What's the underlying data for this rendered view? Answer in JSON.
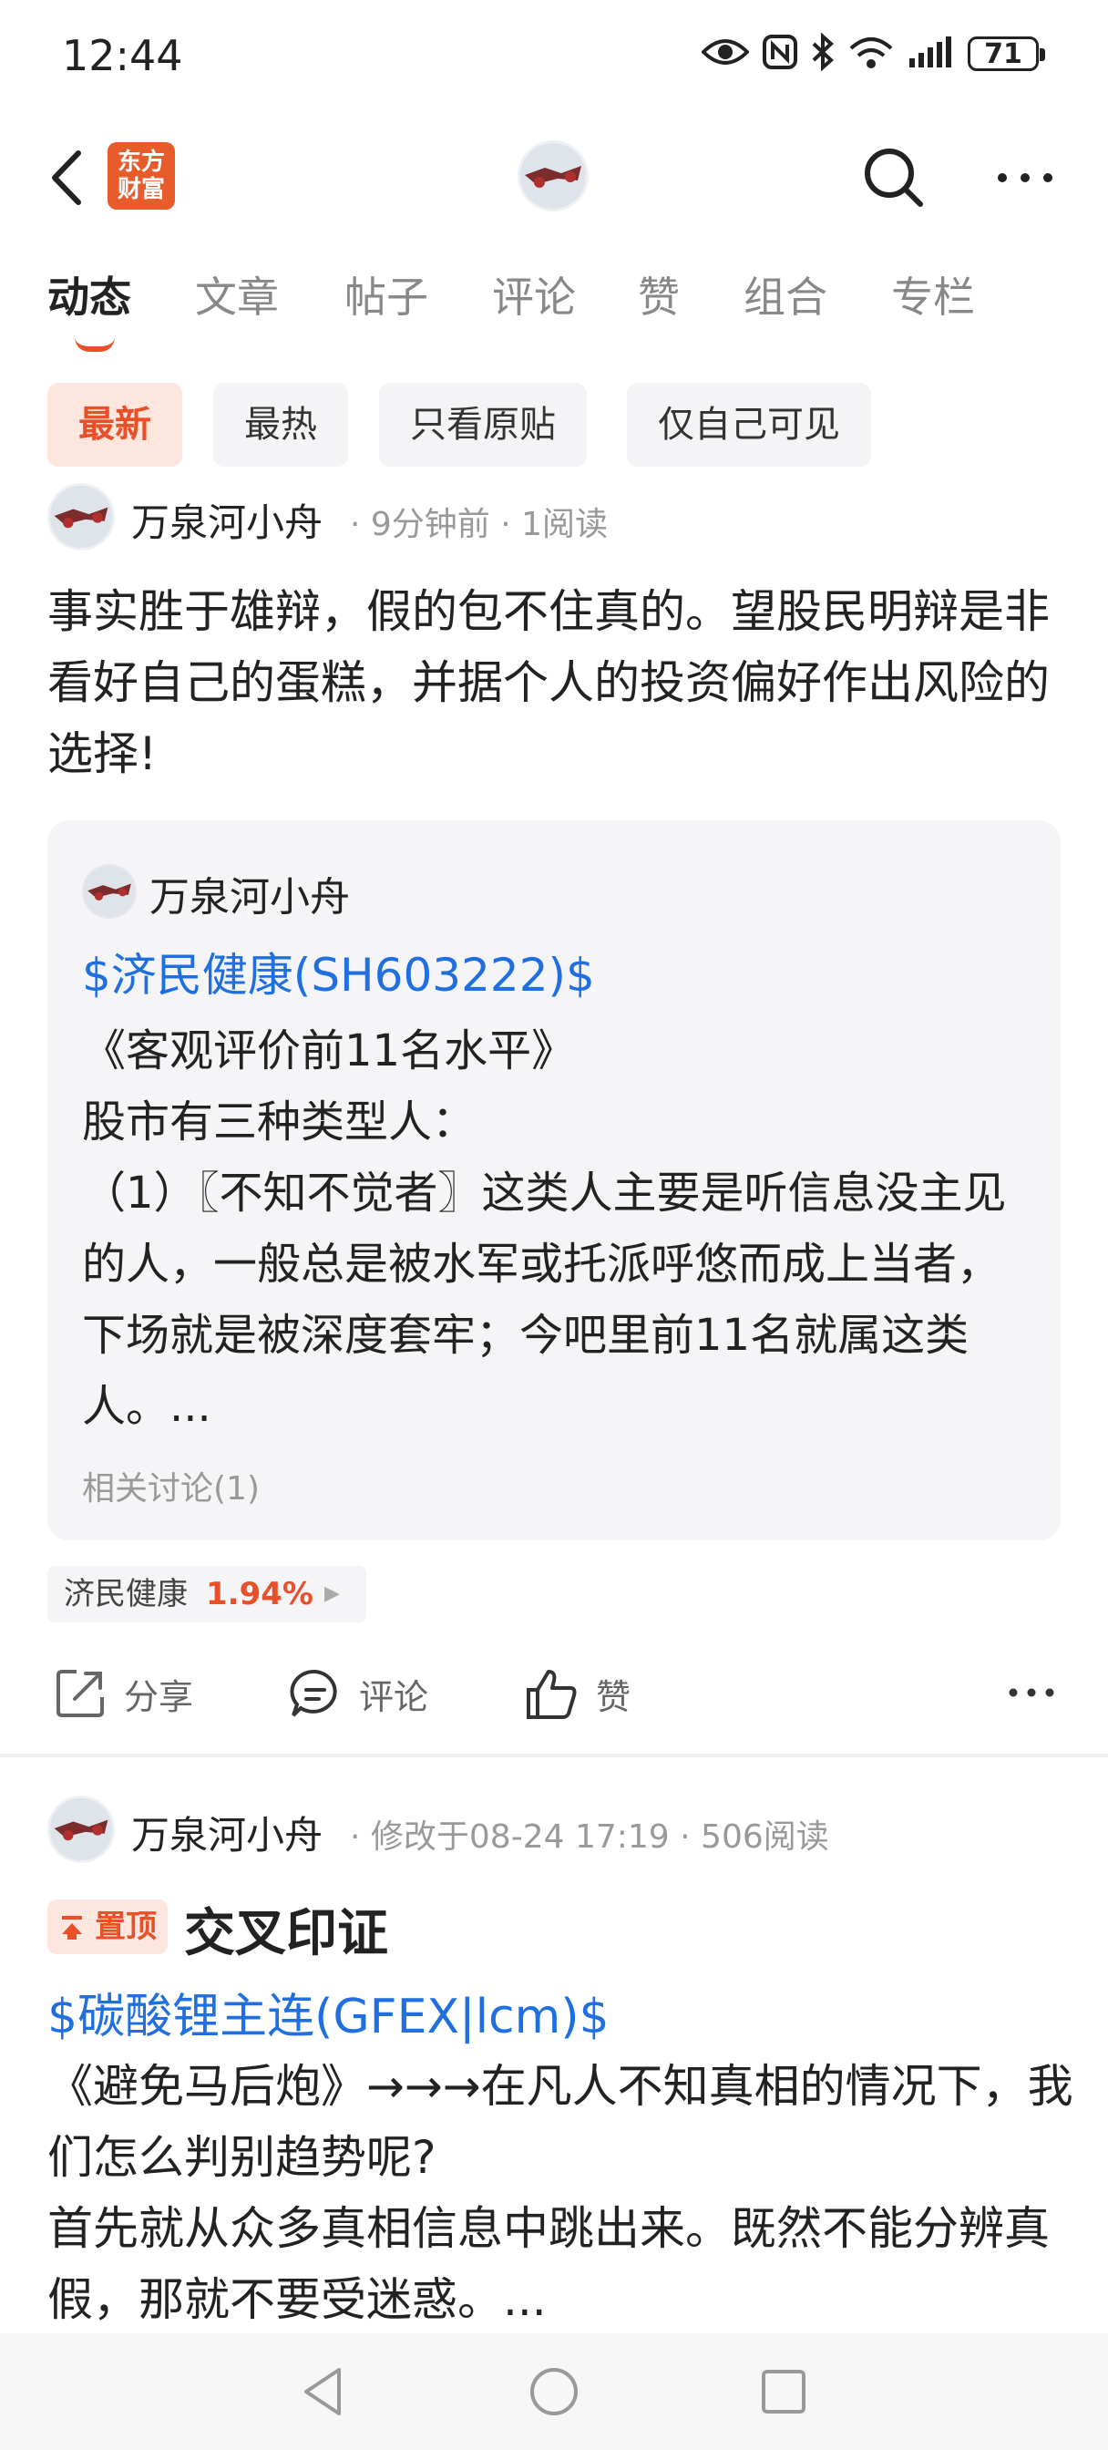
{
  "status_bar": {
    "time": "12:44",
    "battery": "71"
  },
  "header": {
    "logo_line1": "东方",
    "logo_line2": "财富"
  },
  "tabs": [
    {
      "label": "动态",
      "active": true
    },
    {
      "label": "文章"
    },
    {
      "label": "帖子"
    },
    {
      "label": "评论"
    },
    {
      "label": "赞"
    },
    {
      "label": "组合"
    },
    {
      "label": "专栏"
    }
  ],
  "filters": [
    {
      "label": "最新",
      "active": true
    },
    {
      "label": "最热"
    },
    {
      "label": "只看原贴"
    },
    {
      "label": "仅自己可见"
    }
  ],
  "post1": {
    "author": "万泉河小舟",
    "time": "9分钟前",
    "reads": "1阅读",
    "text": "事实胜于雄辩，假的包不住真的。望股民明辩是非看好自己的蛋糕，并据个人的投资偏好作出风险的选择!",
    "quote": {
      "author": "万泉河小舟",
      "stock_link": "$济民健康(SH603222)$",
      "lines": [
        "《客观评价前11名水平》",
        "股市有三种类型人：",
        "（1）〖不知不觉者〗这类人主要是听信息没主见的人，一般总是被水军或托派呼悠而成上当者，下场就是被深度套牢；今吧里前11名就属这类人。..."
      ],
      "related": "相关讨论(1)"
    },
    "stock_tag": {
      "name": "济民健康",
      "change": "1.94%"
    },
    "actions": {
      "share": "分享",
      "comment": "评论",
      "like": "赞"
    }
  },
  "post2": {
    "author": "万泉河小舟",
    "time": "修改于08-24 17:19",
    "reads": "506阅读",
    "pin_label": "置顶",
    "title": "交叉印证",
    "stock_link": "$碳酸锂主连(GFEX|lcm)$",
    "text": "《避免马后炮》→→→在凡人不知真相的情况下，我们怎么判别趋势呢?\n首先就从众多真相信息中跳出来。既然不能分辨真假，那就不要受迷惑。..."
  },
  "colors": {
    "accent": "#e8502a",
    "link": "#1f6fe0"
  }
}
